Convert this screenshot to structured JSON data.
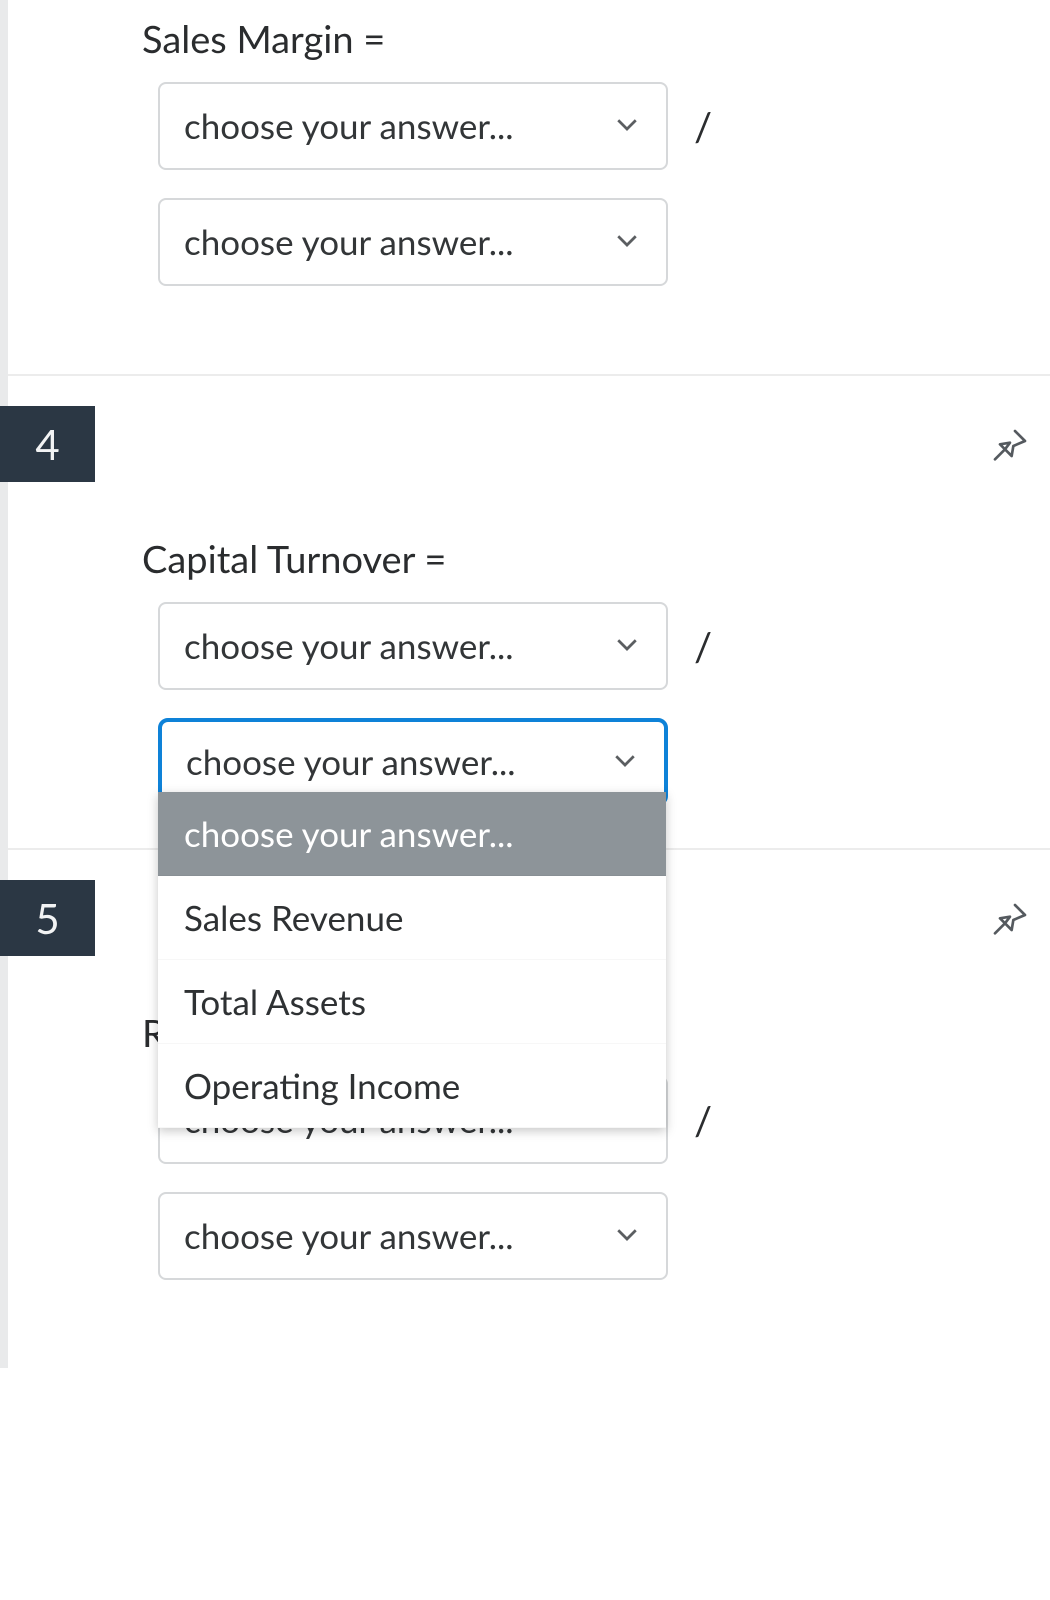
{
  "placeholder": "choose your answer...",
  "slash": "/",
  "q3": {
    "title": "Sales Margin ="
  },
  "q4": {
    "number": "4",
    "title": "Capital Turnover =",
    "dropdown_options": [
      "choose your answer...",
      "Sales Revenue",
      "Total Assets",
      "Operating Income"
    ]
  },
  "q5": {
    "number": "5",
    "partial_title": "R"
  }
}
